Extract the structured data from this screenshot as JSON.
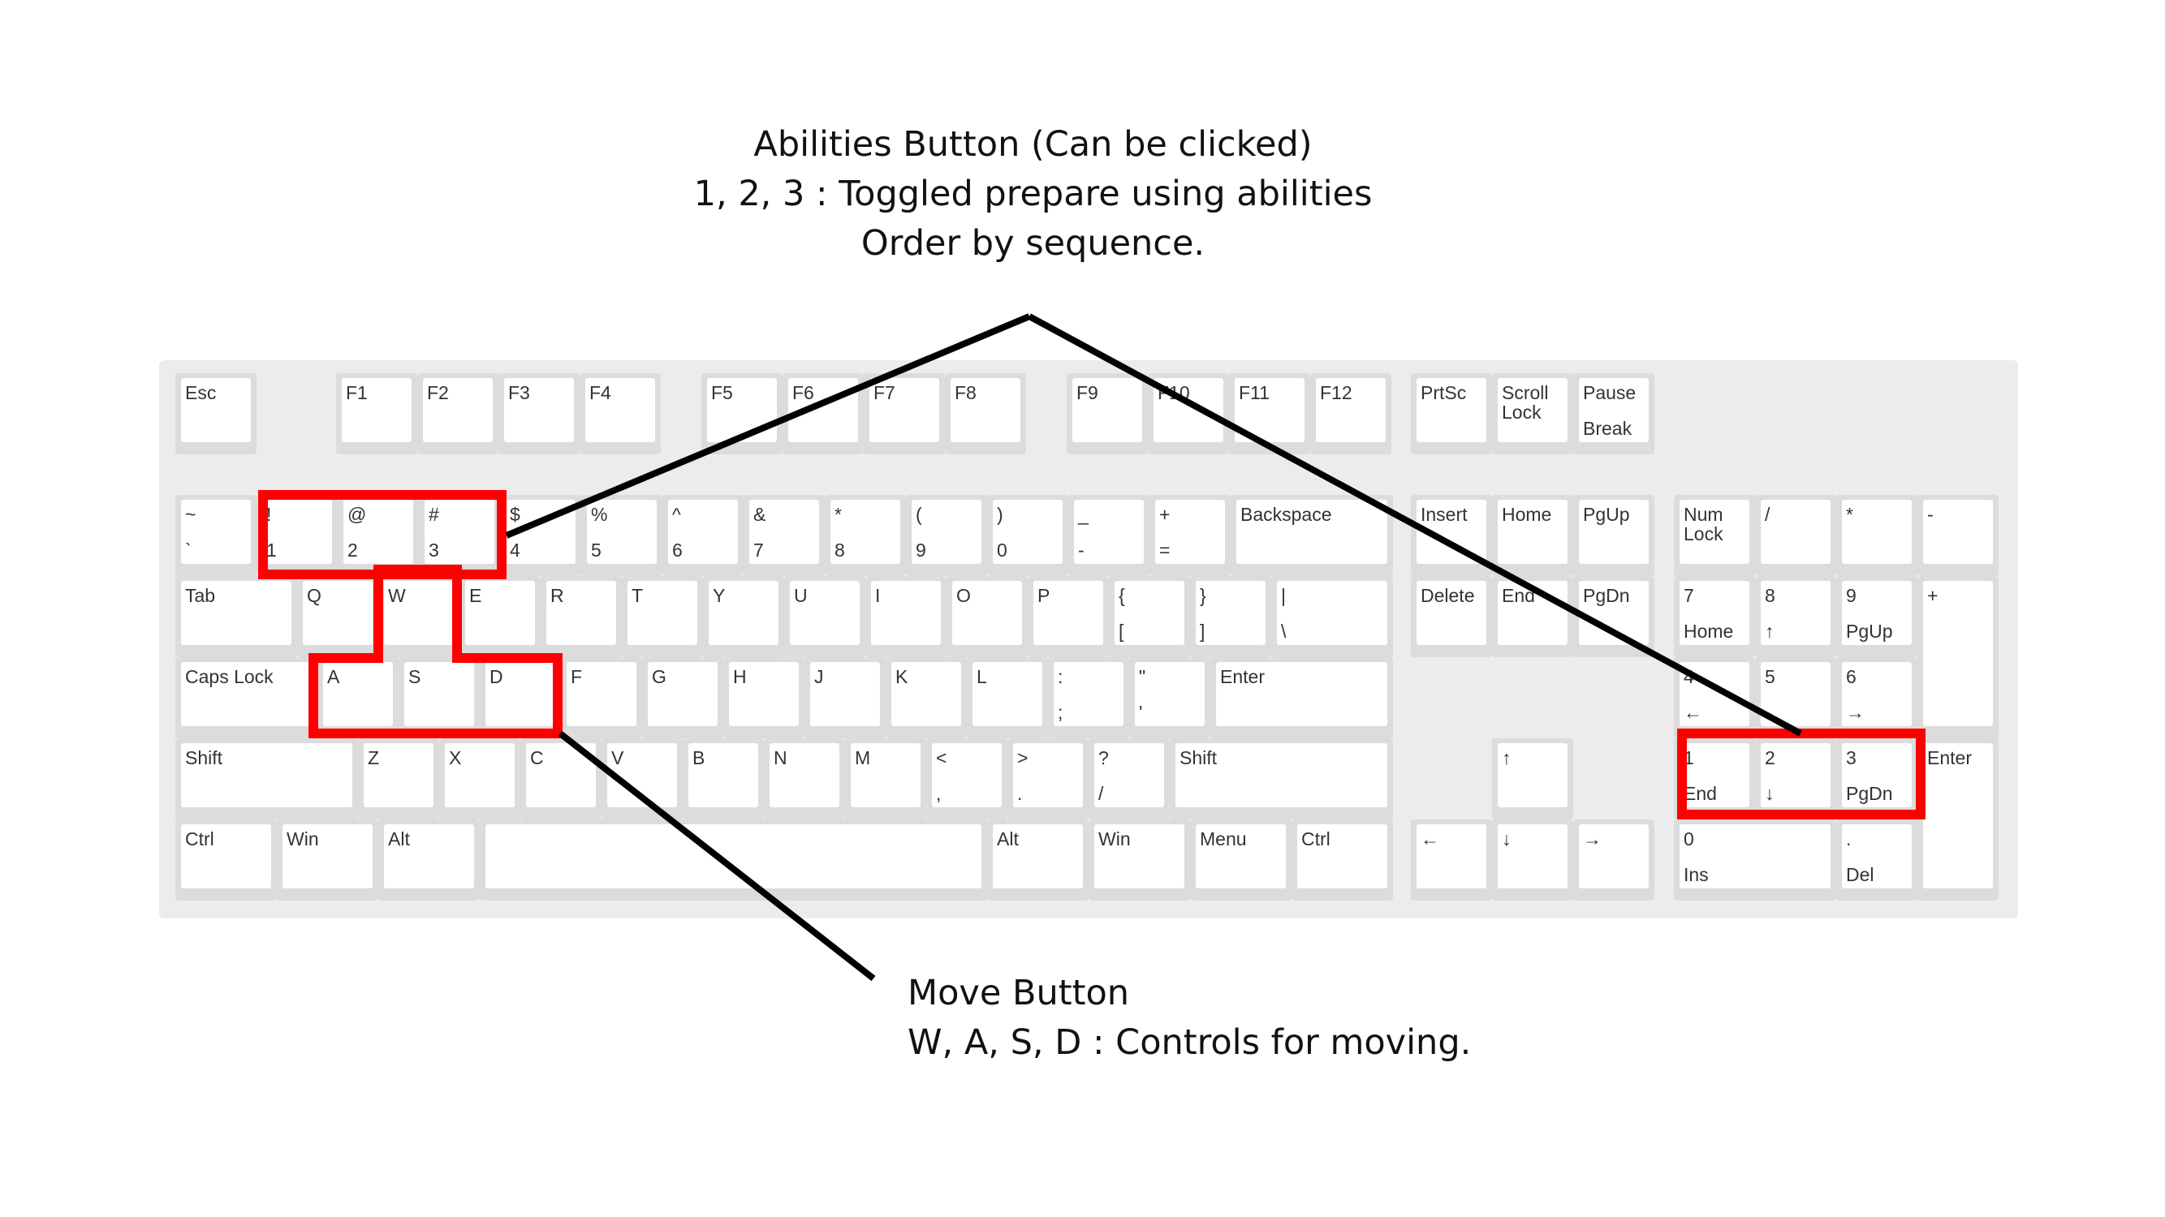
{
  "annotations": {
    "abilities": {
      "line1": "Abilities Button (Can be clicked)",
      "line2": "1, 2, 3 : Toggled prepare using abilities",
      "line3": "Order by sequence."
    },
    "move": {
      "line1": "Move Button",
      "line2": "W, A, S, D : Controls for moving."
    }
  },
  "highlight_color": "#ff0000",
  "keyboard": {
    "function_row": [
      {
        "id": "esc",
        "top": "Esc",
        "bottom": ""
      },
      {
        "id": "f1",
        "top": "F1",
        "bottom": ""
      },
      {
        "id": "f2",
        "top": "F2",
        "bottom": ""
      },
      {
        "id": "f3",
        "top": "F3",
        "bottom": ""
      },
      {
        "id": "f4",
        "top": "F4",
        "bottom": ""
      },
      {
        "id": "f5",
        "top": "F5",
        "bottom": ""
      },
      {
        "id": "f6",
        "top": "F6",
        "bottom": ""
      },
      {
        "id": "f7",
        "top": "F7",
        "bottom": ""
      },
      {
        "id": "f8",
        "top": "F8",
        "bottom": ""
      },
      {
        "id": "f9",
        "top": "F9",
        "bottom": ""
      },
      {
        "id": "f10",
        "top": "F10",
        "bottom": ""
      },
      {
        "id": "f11",
        "top": "F11",
        "bottom": ""
      },
      {
        "id": "f12",
        "top": "F12",
        "bottom": ""
      },
      {
        "id": "prtsc",
        "top": "PrtSc",
        "bottom": ""
      },
      {
        "id": "scroll-lock",
        "top": "Scroll\nLock",
        "bottom": ""
      },
      {
        "id": "pause",
        "top": "Pause",
        "bottom": "Break"
      }
    ],
    "number_row": [
      {
        "id": "backtick",
        "top": "~",
        "bottom": "`"
      },
      {
        "id": "1",
        "top": "!",
        "bottom": "1"
      },
      {
        "id": "2",
        "top": "@",
        "bottom": "2"
      },
      {
        "id": "3",
        "top": "#",
        "bottom": "3"
      },
      {
        "id": "4",
        "top": "$",
        "bottom": "4"
      },
      {
        "id": "5",
        "top": "%",
        "bottom": "5"
      },
      {
        "id": "6",
        "top": "^",
        "bottom": "6"
      },
      {
        "id": "7",
        "top": "&",
        "bottom": "7"
      },
      {
        "id": "8",
        "top": "*",
        "bottom": "8"
      },
      {
        "id": "9",
        "top": "(",
        "bottom": "9"
      },
      {
        "id": "0",
        "top": ")",
        "bottom": "0"
      },
      {
        "id": "minus",
        "top": "_",
        "bottom": "-"
      },
      {
        "id": "equals",
        "top": "+",
        "bottom": "="
      },
      {
        "id": "backspace",
        "top": "Backspace",
        "bottom": ""
      }
    ],
    "qwerty_row": [
      {
        "id": "tab",
        "top": "Tab",
        "bottom": ""
      },
      {
        "id": "q",
        "top": "Q",
        "bottom": ""
      },
      {
        "id": "w",
        "top": "W",
        "bottom": ""
      },
      {
        "id": "e",
        "top": "E",
        "bottom": ""
      },
      {
        "id": "r",
        "top": "R",
        "bottom": ""
      },
      {
        "id": "t",
        "top": "T",
        "bottom": ""
      },
      {
        "id": "y",
        "top": "Y",
        "bottom": ""
      },
      {
        "id": "u",
        "top": "U",
        "bottom": ""
      },
      {
        "id": "i",
        "top": "I",
        "bottom": ""
      },
      {
        "id": "o",
        "top": "O",
        "bottom": ""
      },
      {
        "id": "p",
        "top": "P",
        "bottom": ""
      },
      {
        "id": "lbracket",
        "top": "{",
        "bottom": "["
      },
      {
        "id": "rbracket",
        "top": "}",
        "bottom": "]"
      },
      {
        "id": "backslash",
        "top": "|",
        "bottom": "\\"
      }
    ],
    "home_row": [
      {
        "id": "caps-lock",
        "top": "Caps Lock",
        "bottom": ""
      },
      {
        "id": "a",
        "top": "A",
        "bottom": ""
      },
      {
        "id": "s",
        "top": "S",
        "bottom": ""
      },
      {
        "id": "d",
        "top": "D",
        "bottom": ""
      },
      {
        "id": "f",
        "top": "F",
        "bottom": ""
      },
      {
        "id": "g",
        "top": "G",
        "bottom": ""
      },
      {
        "id": "h",
        "top": "H",
        "bottom": ""
      },
      {
        "id": "j",
        "top": "J",
        "bottom": ""
      },
      {
        "id": "k",
        "top": "K",
        "bottom": ""
      },
      {
        "id": "l",
        "top": "L",
        "bottom": ""
      },
      {
        "id": "semicolon",
        "top": ":",
        "bottom": ";"
      },
      {
        "id": "quote",
        "top": "\"",
        "bottom": "'"
      },
      {
        "id": "enter",
        "top": "Enter",
        "bottom": ""
      }
    ],
    "shift_row": [
      {
        "id": "left-shift",
        "top": "Shift",
        "bottom": ""
      },
      {
        "id": "z",
        "top": "Z",
        "bottom": ""
      },
      {
        "id": "x",
        "top": "X",
        "bottom": ""
      },
      {
        "id": "c",
        "top": "C",
        "bottom": ""
      },
      {
        "id": "v",
        "top": "V",
        "bottom": ""
      },
      {
        "id": "b",
        "top": "B",
        "bottom": ""
      },
      {
        "id": "n",
        "top": "N",
        "bottom": ""
      },
      {
        "id": "m",
        "top": "M",
        "bottom": ""
      },
      {
        "id": "comma",
        "top": "<",
        "bottom": ","
      },
      {
        "id": "period",
        "top": ">",
        "bottom": "."
      },
      {
        "id": "slash",
        "top": "?",
        "bottom": "/"
      },
      {
        "id": "right-shift",
        "top": "Shift",
        "bottom": ""
      }
    ],
    "bottom_row": [
      {
        "id": "left-ctrl",
        "top": "Ctrl",
        "bottom": ""
      },
      {
        "id": "left-win",
        "top": "Win",
        "bottom": ""
      },
      {
        "id": "left-alt",
        "top": "Alt",
        "bottom": ""
      },
      {
        "id": "space",
        "top": "",
        "bottom": ""
      },
      {
        "id": "right-alt",
        "top": "Alt",
        "bottom": ""
      },
      {
        "id": "right-win",
        "top": "Win",
        "bottom": ""
      },
      {
        "id": "menu",
        "top": "Menu",
        "bottom": ""
      },
      {
        "id": "right-ctrl",
        "top": "Ctrl",
        "bottom": ""
      }
    ],
    "navigation": [
      {
        "id": "insert",
        "top": "Insert",
        "bottom": ""
      },
      {
        "id": "home",
        "top": "Home",
        "bottom": ""
      },
      {
        "id": "pgup",
        "top": "PgUp",
        "bottom": ""
      },
      {
        "id": "delete",
        "top": "Delete",
        "bottom": ""
      },
      {
        "id": "end",
        "top": "End",
        "bottom": ""
      },
      {
        "id": "pgdn",
        "top": "PgDn",
        "bottom": ""
      }
    ],
    "arrows": [
      {
        "id": "up",
        "top": "↑",
        "bottom": ""
      },
      {
        "id": "left",
        "top": "←",
        "bottom": ""
      },
      {
        "id": "down",
        "top": "↓",
        "bottom": ""
      },
      {
        "id": "right",
        "top": "→",
        "bottom": ""
      }
    ],
    "numpad": [
      {
        "id": "num-lock",
        "top": "Num\nLock",
        "bottom": ""
      },
      {
        "id": "num-divide",
        "top": "/",
        "bottom": ""
      },
      {
        "id": "num-multiply",
        "top": "*",
        "bottom": ""
      },
      {
        "id": "num-minus",
        "top": "-",
        "bottom": ""
      },
      {
        "id": "num-7",
        "top": "7",
        "bottom": "Home"
      },
      {
        "id": "num-8",
        "top": "8",
        "bottom": "↑"
      },
      {
        "id": "num-9",
        "top": "9",
        "bottom": "PgUp"
      },
      {
        "id": "num-plus",
        "top": "+",
        "bottom": ""
      },
      {
        "id": "num-4",
        "top": "4",
        "bottom": "←"
      },
      {
        "id": "num-5",
        "top": "5",
        "bottom": ""
      },
      {
        "id": "num-6",
        "top": "6",
        "bottom": "→"
      },
      {
        "id": "num-1",
        "top": "1",
        "bottom": "End"
      },
      {
        "id": "num-2",
        "top": "2",
        "bottom": "↓"
      },
      {
        "id": "num-3",
        "top": "3",
        "bottom": "PgDn"
      },
      {
        "id": "num-enter",
        "top": "Enter",
        "bottom": ""
      },
      {
        "id": "num-0",
        "top": "0",
        "bottom": "Ins"
      },
      {
        "id": "num-decimal",
        "top": ".",
        "bottom": "Del"
      }
    ]
  }
}
